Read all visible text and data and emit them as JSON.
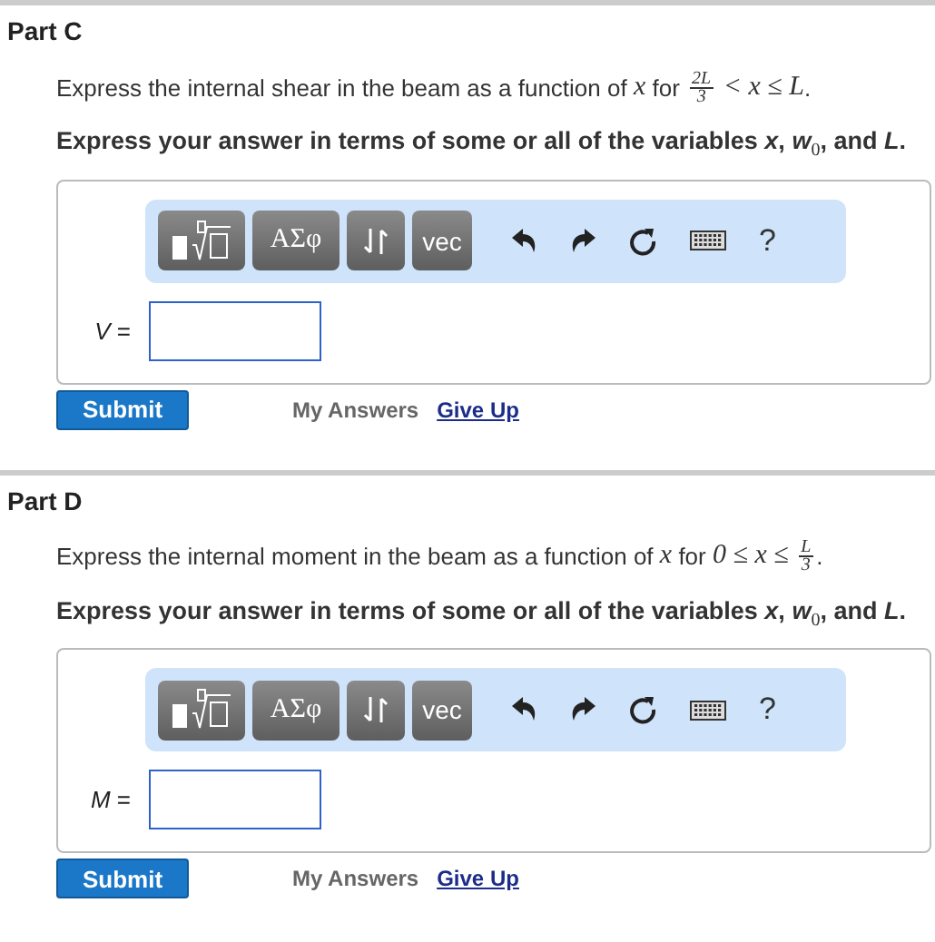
{
  "parts": [
    {
      "title": "Part C",
      "prompt": [
        {
          "kind": "text",
          "text": "Express the internal shear in the beam as a function of "
        },
        {
          "kind": "math",
          "text": "x"
        },
        {
          "kind": "text",
          "text": " for "
        },
        {
          "kind": "frac",
          "num": "2L",
          "den": "3"
        },
        {
          "kind": "math",
          "text": " < x ≤ L"
        },
        {
          "kind": "text",
          "text": "."
        }
      ],
      "instruction": "Express your answer in terms of some or all of the variables *x*, *w*$_{0}$, and *L*.",
      "toolbar": {
        "symbols_label": "ΑΣφ",
        "vec_label": "vec",
        "help_label": "?"
      },
      "answer_label": "*V* =",
      "buttons": {
        "submit": "Submit",
        "my_answers": "My Answers",
        "give_up": "Give Up"
      }
    },
    {
      "title": "Part D",
      "prompt": [
        {
          "kind": "text",
          "text": "Express the internal moment in the beam as a function of "
        },
        {
          "kind": "math",
          "text": "x"
        },
        {
          "kind": "text",
          "text": " for "
        },
        {
          "kind": "math",
          "text": "0 ≤ x ≤ "
        },
        {
          "kind": "frac",
          "num": "L",
          "den": "3"
        },
        {
          "kind": "text",
          "text": "."
        }
      ],
      "instruction": "Express your answer in terms of some or all of the variables *x*, *w*$_{0}$, and *L*.",
      "toolbar": {
        "symbols_label": "ΑΣφ",
        "vec_label": "vec",
        "help_label": "?"
      },
      "answer_label": "*M* =",
      "buttons": {
        "submit": "Submit",
        "my_answers": "My Answers",
        "give_up": "Give Up"
      }
    }
  ]
}
